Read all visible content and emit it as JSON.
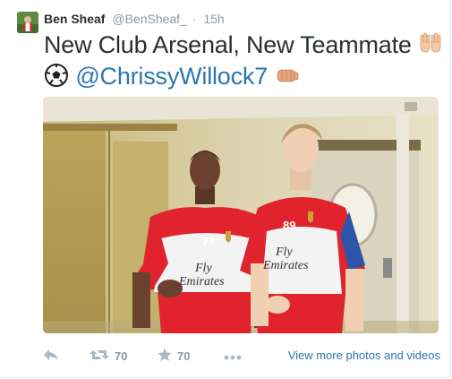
{
  "tweet": {
    "display_name": "Ben Sheaf",
    "handle": "@BenSheaf_",
    "separator": "·",
    "timestamp": "15h",
    "text_line1": "New Club Arsenal, New Teammate",
    "mention": "@ChrissyWillock7",
    "emoji_1": "raised-hands",
    "emoji_2": "soccer-ball",
    "emoji_3": "fisted-hand",
    "photo": {
      "description_icon": "tweet-photo",
      "left_shirt_number": "77",
      "right_shirt_number": "89",
      "sponsor_line1": "Fly",
      "sponsor_line2": "Emirates"
    }
  },
  "actions": {
    "reply_icon": "reply-icon",
    "retweet_icon": "retweet-icon",
    "retweet_count": "70",
    "favorite_icon": "star-icon",
    "favorite_count": "70",
    "more_icon": "more-icon",
    "view_more_label": "View more photos and videos"
  },
  "colors": {
    "link": "#2a77b0",
    "muted": "#8899a6",
    "text": "#292f33",
    "arsenal_red": "#e0232d"
  }
}
